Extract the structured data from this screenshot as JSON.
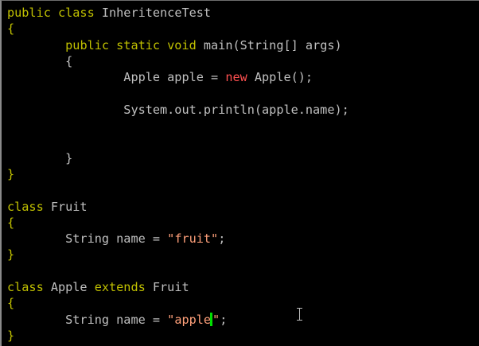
{
  "editor": {
    "lines": [
      {
        "tokens": [
          {
            "t": "public class",
            "c": "kw"
          },
          {
            "t": " InheritenceTest",
            "c": "plain"
          }
        ]
      },
      {
        "tokens": [
          {
            "t": "{",
            "c": "kw"
          }
        ]
      },
      {
        "tokens": [
          {
            "t": "        ",
            "c": "plain"
          },
          {
            "t": "public static void",
            "c": "kw"
          },
          {
            "t": " main(String[] args)",
            "c": "plain"
          }
        ]
      },
      {
        "tokens": [
          {
            "t": "        {",
            "c": "plain"
          }
        ]
      },
      {
        "tokens": [
          {
            "t": "                Apple apple = ",
            "c": "plain"
          },
          {
            "t": "new",
            "c": "kw-pink"
          },
          {
            "t": " Apple();",
            "c": "plain"
          }
        ]
      },
      {
        "tokens": []
      },
      {
        "tokens": [
          {
            "t": "                System.out.println(apple.name);",
            "c": "plain"
          }
        ]
      },
      {
        "tokens": []
      },
      {
        "tokens": []
      },
      {
        "tokens": [
          {
            "t": "        }",
            "c": "plain"
          }
        ]
      },
      {
        "tokens": [
          {
            "t": "}",
            "c": "kw"
          }
        ]
      },
      {
        "tokens": []
      },
      {
        "tokens": [
          {
            "t": "class",
            "c": "kw"
          },
          {
            "t": " Fruit",
            "c": "plain"
          }
        ]
      },
      {
        "tokens": [
          {
            "t": "{",
            "c": "kw"
          }
        ]
      },
      {
        "tokens": [
          {
            "t": "        String name = ",
            "c": "plain"
          },
          {
            "t": "\"fruit\"",
            "c": "str"
          },
          {
            "t": ";",
            "c": "plain"
          }
        ]
      },
      {
        "tokens": [
          {
            "t": "}",
            "c": "kw"
          }
        ]
      },
      {
        "tokens": []
      },
      {
        "tokens": [
          {
            "t": "class",
            "c": "kw"
          },
          {
            "t": " Apple ",
            "c": "plain"
          },
          {
            "t": "extends",
            "c": "kw"
          },
          {
            "t": " Fruit",
            "c": "plain"
          }
        ]
      },
      {
        "tokens": [
          {
            "t": "{",
            "c": "kw"
          }
        ]
      },
      {
        "tokens": [
          {
            "t": "        String name = ",
            "c": "plain"
          },
          {
            "t": "\"apple",
            "c": "str"
          },
          {
            "t": "",
            "c": "cursor"
          },
          {
            "t": "\"",
            "c": "str"
          },
          {
            "t": ";",
            "c": "plain"
          }
        ]
      },
      {
        "tokens": [
          {
            "t": "}",
            "c": "kw"
          }
        ]
      }
    ]
  },
  "colors": {
    "background": "#000000",
    "keyword": "#c0c000",
    "keyword_new": "#ff5050",
    "string": "#ffa07a",
    "plain_text": "#c0c0c0",
    "cursor": "#00e000"
  },
  "icons": {
    "mouse_pointer": "text-cursor-ibeam-icon"
  }
}
